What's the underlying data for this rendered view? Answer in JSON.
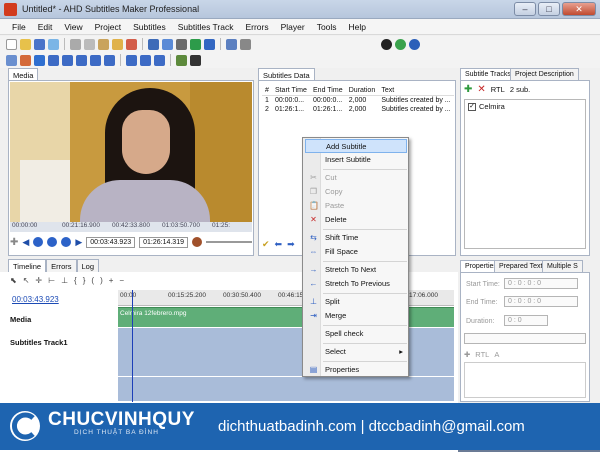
{
  "window": {
    "title": "Untitled* - AHD Subtitles Maker Professional",
    "buttons": [
      "–",
      "□",
      "✕"
    ]
  },
  "menu": [
    "File",
    "Edit",
    "View",
    "Project",
    "Subtitles",
    "Subtitles Track",
    "Errors",
    "Player",
    "Tools",
    "Help"
  ],
  "media": {
    "tab": "Media",
    "ticks": [
      "00:00:00",
      "00:21:16.900",
      "00:42:33.800",
      "01:03:50.700",
      "01:25:"
    ],
    "current_time": "00:03:43.923",
    "duration_time": "01:26:14.319"
  },
  "subtitles_data": {
    "tab": "Subtitles Data",
    "columns": [
      "#",
      "Start Time",
      "End Time",
      "Duration",
      "Text"
    ],
    "rows": [
      [
        "1",
        "00:00:0...",
        "00:00:0...",
        "2,000",
        "Subtitles created by ..."
      ],
      [
        "2",
        "01:26:1...",
        "01:26:1...",
        "2,000",
        "Subtitles created by ..."
      ]
    ]
  },
  "context_menu": {
    "items": [
      {
        "label": "Add Subtitle",
        "icon": "",
        "state": "highlighted"
      },
      {
        "label": "Insert Subtitle",
        "icon": "",
        "state": "normal"
      },
      {
        "label": "Cut",
        "icon": "✂",
        "state": "disabled"
      },
      {
        "label": "Copy",
        "icon": "❐",
        "state": "disabled"
      },
      {
        "label": "Paste",
        "icon": "📋",
        "state": "disabled"
      },
      {
        "label": "Delete",
        "icon": "✕",
        "state": "normal"
      },
      {
        "label": "Shift Time",
        "icon": "⇆",
        "state": "normal"
      },
      {
        "label": "Fill Space",
        "icon": "⇔",
        "state": "normal"
      },
      {
        "label": "Stretch To Next",
        "icon": "→",
        "state": "normal"
      },
      {
        "label": "Stretch To Previous",
        "icon": "←",
        "state": "normal"
      },
      {
        "label": "Split",
        "icon": "⊥",
        "state": "normal"
      },
      {
        "label": "Merge",
        "icon": "⇥",
        "state": "normal"
      },
      {
        "label": "Spell check",
        "icon": "",
        "state": "normal"
      },
      {
        "label": "Select",
        "icon": "",
        "state": "submenu"
      },
      {
        "label": "Properties",
        "icon": "▤",
        "state": "normal"
      }
    ]
  },
  "subtitle_tracks": {
    "tabs": [
      "Subtitle Tracks",
      "Project Description"
    ],
    "rtl": "RTL",
    "count": "2 sub.",
    "tracks": [
      {
        "name": "Celmira",
        "checked": true
      }
    ]
  },
  "properties": {
    "tabs": [
      "Properties",
      "Prepared Text",
      "Multiple S"
    ],
    "labels": [
      "Start Time:",
      "End Time:",
      "Duration:"
    ],
    "spin_value": "0 : 0 : 0 : 0",
    "dur_value": "0 : 0",
    "rtl": "RTL"
  },
  "timeline": {
    "tabs": [
      "Timeline",
      "Errors",
      "Log"
    ],
    "current": "00:03:43.923",
    "ruler": [
      "00:00",
      "00:15:25.200",
      "00:30:50.400",
      "00:46:15.600",
      "01:17:06.000"
    ],
    "rows": [
      "Media",
      "Subtitles Track1"
    ],
    "clip": "Celmira 12febrero.mpg"
  },
  "banner": {
    "brand": "CHUCVINHQUY",
    "sub": "DỊCH THUẬT BA ĐÌNH",
    "contact": "dichthuatbadinh.com | dtccbadinh@gmail.com"
  }
}
